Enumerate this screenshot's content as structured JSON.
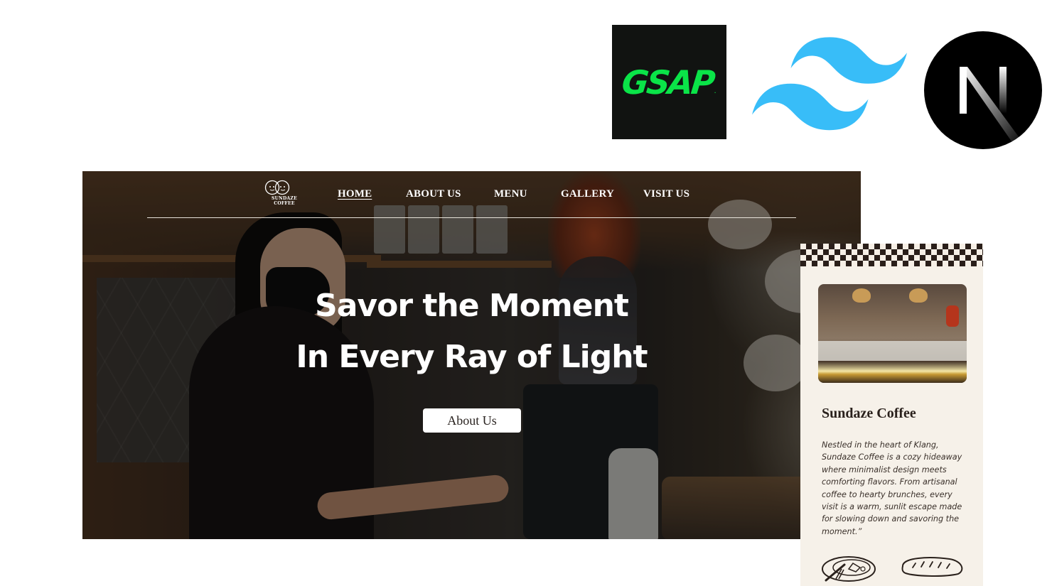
{
  "tech_logos": {
    "gsap": {
      "text": "GSAP",
      "dot": ".",
      "bg": "#111311",
      "color": "#0ae448"
    },
    "tailwind": {
      "name": "tailwind-logo",
      "color": "#38bdf8"
    },
    "nextjs": {
      "name": "nextjs-logo",
      "bg": "#000000",
      "letter": "N"
    }
  },
  "hero": {
    "logo_text": "SUNDAZE COFFEE",
    "nav": [
      {
        "label": "HOME",
        "active": true
      },
      {
        "label": "ABOUT US",
        "active": false
      },
      {
        "label": "MENU",
        "active": false
      },
      {
        "label": "GALLERY",
        "active": false
      },
      {
        "label": "VISIT US",
        "active": false
      }
    ],
    "title_line1": "Savor the Moment",
    "title_line2": "In Every Ray of Light",
    "button_label": "About Us"
  },
  "mobile": {
    "title": "Sundaze Coffee",
    "description": "Nestled in the heart of Klang, Sundaze Coffee is a cozy hideaway where minimalist design meets comforting flavors. From artisanal coffee to hearty brunches, every visit is a warm, sunlit escape made for slowing down and savoring the moment.”",
    "icons": [
      "plate-cutlery-icon",
      "bread-icon"
    ]
  },
  "colors": {
    "cream": "#f6f1e9",
    "checker_dark": "#2a1f1a",
    "text_dark": "#2a211c"
  }
}
